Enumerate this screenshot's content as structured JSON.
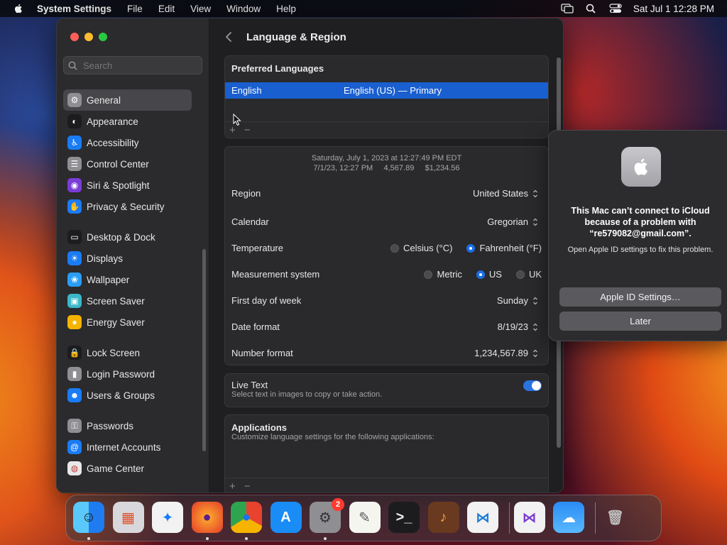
{
  "menubar": {
    "app": "System Settings",
    "items": [
      "File",
      "Edit",
      "View",
      "Window",
      "Help"
    ],
    "clock": "Sat Jul 1  12:28 PM"
  },
  "sidebar": {
    "search_placeholder": "Search",
    "groups": [
      [
        {
          "label": "General",
          "icon": "gear-icon",
          "color": "#8e8e93",
          "active": true
        },
        {
          "label": "Appearance",
          "icon": "appearance-icon",
          "color": "#1c1c1e"
        },
        {
          "label": "Accessibility",
          "icon": "accessibility-icon",
          "color": "#1a7cf5"
        },
        {
          "label": "Control Center",
          "icon": "control-center-icon",
          "color": "#8e8e93"
        },
        {
          "label": "Siri & Spotlight",
          "icon": "siri-icon",
          "color": "#7a3cd6"
        },
        {
          "label": "Privacy & Security",
          "icon": "hand-icon",
          "color": "#1a7cf5"
        }
      ],
      [
        {
          "label": "Desktop & Dock",
          "icon": "dock-icon",
          "color": "#1c1c1e"
        },
        {
          "label": "Displays",
          "icon": "sun-icon",
          "color": "#1a7cf5"
        },
        {
          "label": "Wallpaper",
          "icon": "wallpaper-icon",
          "color": "#2a9df5"
        },
        {
          "label": "Screen Saver",
          "icon": "screensaver-icon",
          "color": "#3ab8c8"
        },
        {
          "label": "Energy Saver",
          "icon": "lightbulb-icon",
          "color": "#f5b400"
        }
      ],
      [
        {
          "label": "Lock Screen",
          "icon": "lock-icon",
          "color": "#1c1c1e"
        },
        {
          "label": "Login Password",
          "icon": "password-lock-icon",
          "color": "#8e8e93"
        },
        {
          "label": "Users & Groups",
          "icon": "users-icon",
          "color": "#1a7cf5"
        }
      ],
      [
        {
          "label": "Passwords",
          "icon": "key-icon",
          "color": "#8e8e93"
        },
        {
          "label": "Internet Accounts",
          "icon": "at-icon",
          "color": "#1a7cf5"
        },
        {
          "label": "Game Center",
          "icon": "game-center-icon",
          "color": "#e8e8e8"
        }
      ]
    ]
  },
  "main": {
    "title": "Language & Region",
    "preferred": {
      "heading": "Preferred Languages",
      "language": "English",
      "language_detail": "English (US) — Primary",
      "plus": "+",
      "minus": "−"
    },
    "formats": {
      "preview_line1": "Saturday, July 1, 2023 at 12:27:49 PM EDT",
      "preview_line2": "7/1/23, 12:27 PM     4,567.89     $1,234.56",
      "region_label": "Region",
      "region_value": "United States",
      "calendar_label": "Calendar",
      "calendar_value": "Gregorian",
      "temperature_label": "Temperature",
      "temp_options": [
        "Celsius (°C)",
        "Fahrenheit (°F)"
      ],
      "temp_selected": "Fahrenheit (°F)",
      "measurement_label": "Measurement system",
      "measure_options": [
        "Metric",
        "US",
        "UK"
      ],
      "measure_selected": "US",
      "first_day_label": "First day of week",
      "first_day_value": "Sunday",
      "date_format_label": "Date format",
      "date_format_value": "8/19/23",
      "number_format_label": "Number format",
      "number_format_value": "1,234,567.89"
    },
    "live_text": {
      "title": "Live Text",
      "subtitle": "Select text in images to copy or take action.",
      "enabled": true
    },
    "applications": {
      "title": "Applications",
      "subtitle": "Customize language settings for the following applications:",
      "plus": "+",
      "minus": "−"
    }
  },
  "notification": {
    "title": "This Mac can’t connect to iCloud because of a problem with “re579082@gmail.com”.",
    "body": "Open Apple ID settings to fix this problem.",
    "primary_button": "Apple ID Settings…",
    "secondary_button": "Later"
  },
  "dock": {
    "apps": [
      {
        "name": "finder",
        "running": true
      },
      {
        "name": "launchpad"
      },
      {
        "name": "safari"
      },
      {
        "name": "firefox",
        "running": true
      },
      {
        "name": "chrome",
        "running": true
      },
      {
        "name": "app-store"
      },
      {
        "name": "system-settings",
        "running": true,
        "badge": "2"
      },
      {
        "name": "textedit"
      },
      {
        "name": "terminal"
      },
      {
        "name": "garageband"
      },
      {
        "name": "vscode"
      },
      {
        "name": "visual-studio"
      },
      {
        "name": "weather"
      },
      {
        "name": "trash"
      }
    ]
  }
}
